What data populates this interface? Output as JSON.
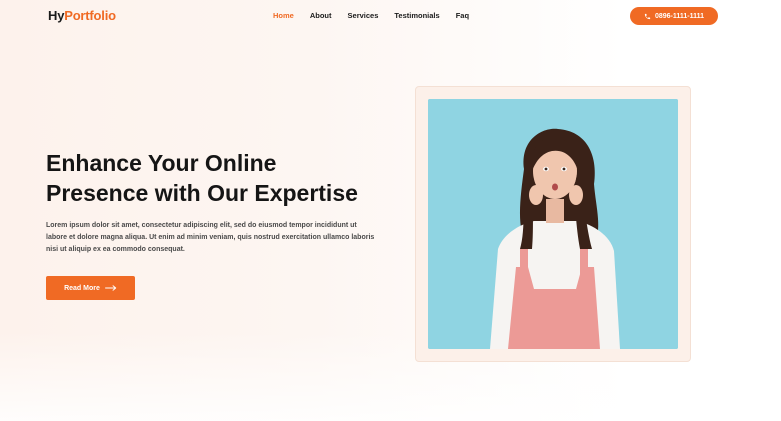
{
  "brand": {
    "logo_part1": "Hy",
    "logo_part2": "Portfolio",
    "accent_color": "#f06a24"
  },
  "nav": {
    "items": [
      {
        "label": "Home",
        "active": true
      },
      {
        "label": "About"
      },
      {
        "label": "Services"
      },
      {
        "label": "Testimonials"
      },
      {
        "label": "Faq"
      }
    ],
    "phone_label": "0896-1111-1111",
    "phone_icon": "phone-icon"
  },
  "hero": {
    "title_line1": "Enhance Your Online",
    "title_line2": "Presence with Our Expertise",
    "description": "Lorem ipsum dolor sit amet, consectetur adipiscing elit, sed do eiusmod tempor incididunt ut labore et dolore magna aliqua. Ut enim ad minim veniam, quis nostrud exercitation ullamco laboris nisi ut aliquip ex ea commodo consequat.",
    "cta_label": "Read More",
    "cta_icon": "arrow-right-icon"
  },
  "image": {
    "subject": "portrait-photo",
    "background_color": "#8fd4e2"
  }
}
